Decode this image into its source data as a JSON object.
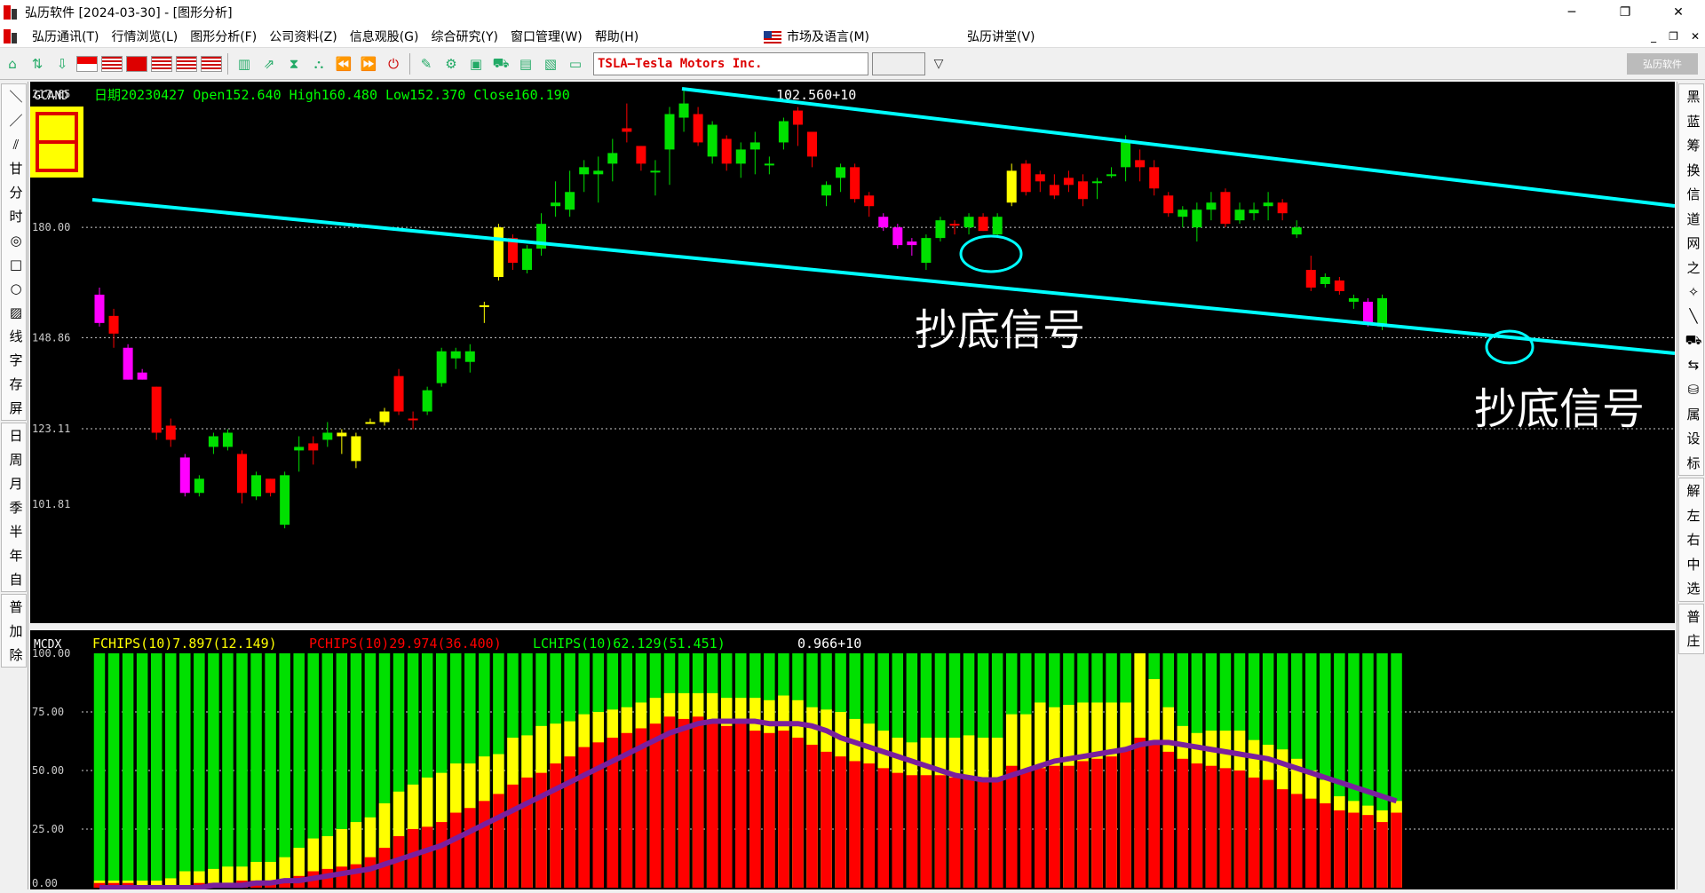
{
  "window": {
    "title": "弘历软件 [2024-03-30] - [图形分析]",
    "minimize": "─",
    "maximize": "❐",
    "close": "✕"
  },
  "menu": {
    "items": [
      "弘历通讯(T)",
      "行情浏览(L)",
      "图形分析(F)",
      "公司资料(Z)",
      "信息观股(G)",
      "综合研究(Y)",
      "窗口管理(W)",
      "帮助(H)"
    ],
    "market_lang": "市场及语言(M)",
    "lecture": "弘历讲堂(V)",
    "mdi_controls": [
      "_",
      "❐",
      "✕"
    ]
  },
  "toolbar": {
    "symbol": "TSLA—Tesla Motors Inc.",
    "brand": "弘历软件",
    "dropdown_icon": "▽"
  },
  "left_toolbar": {
    "tools_group1": [
      "＼",
      "／",
      "⫽",
      "甘",
      "分",
      "时",
      "◎",
      "□",
      "○",
      "▨",
      "线",
      "字",
      "存",
      "屏"
    ],
    "tools_group2": [
      "日",
      "周",
      "月",
      "季",
      "半",
      "年",
      "自"
    ],
    "tools_group3": [
      "普",
      "加",
      "除"
    ]
  },
  "right_toolbar": {
    "group1": [
      "黑",
      "蓝",
      "筹",
      "换",
      "信",
      "道",
      "网",
      "之",
      "✧",
      "╲",
      "⛟",
      "⇆",
      "⛁",
      "属",
      "设",
      "标"
    ],
    "group2": [
      "解",
      "左",
      "右",
      "中",
      "选"
    ],
    "group3": [
      "普",
      "庄"
    ]
  },
  "main_chart": {
    "indicator": "GCAND",
    "info": "日期20230427  Open152.640  High160.480  Low152.370  Close160.190",
    "center_label": "102.560+10",
    "y_labels": [
      "217.65",
      "180.00",
      "148.86",
      "123.11",
      "101.81"
    ],
    "annotation_1": "抄底信号",
    "annotation_2": "抄底信号",
    "colors": {
      "up": "#00e000",
      "down": "#ff0000",
      "yellow": "#ffff00",
      "magenta": "#ff00ff",
      "channel": "#00ffff",
      "background": "#000000"
    }
  },
  "sub_chart": {
    "indicator": "MCDX",
    "fchips": "FCHIPS(10)7.897(12.149)",
    "pchips": "PCHIPS(10)29.974(36.400)",
    "lchips": "LCHIPS(10)62.129(51.451)",
    "center_label": "0.966+10",
    "y_labels": [
      "100.00",
      "75.00",
      "50.00",
      "25.00",
      "0.00"
    ],
    "colors": {
      "red": "#ff0000",
      "yellow": "#ffff00",
      "green": "#00e000",
      "ma": "#7a1f9e"
    }
  },
  "chart_data": {
    "type": "candlestick",
    "y_axis_ticks": [
      217.65,
      180.0,
      148.86,
      123.11,
      101.81
    ],
    "candles": [
      {
        "o": 161,
        "h": 163,
        "l": 152,
        "c": 153,
        "col": "magenta"
      },
      {
        "o": 155,
        "h": 157,
        "l": 146,
        "c": 150,
        "col": "red"
      },
      {
        "o": 146,
        "h": 147,
        "l": 137,
        "c": 137,
        "col": "magenta"
      },
      {
        "o": 139,
        "h": 140,
        "l": 137,
        "c": 137,
        "col": "magenta"
      },
      {
        "o": 135,
        "h": 135,
        "l": 120,
        "c": 122,
        "col": "red"
      },
      {
        "o": 124,
        "h": 126,
        "l": 118,
        "c": 120,
        "col": "red"
      },
      {
        "o": 115,
        "h": 116,
        "l": 104,
        "c": 105,
        "col": "magenta"
      },
      {
        "o": 105,
        "h": 110,
        "l": 104,
        "c": 109,
        "col": "green"
      },
      {
        "o": 118,
        "h": 122,
        "l": 116,
        "c": 121,
        "col": "green"
      },
      {
        "o": 118,
        "h": 123,
        "l": 117,
        "c": 122,
        "col": "green"
      },
      {
        "o": 116,
        "h": 117,
        "l": 102,
        "c": 105,
        "col": "red"
      },
      {
        "o": 104,
        "h": 111,
        "l": 103,
        "c": 110,
        "col": "green"
      },
      {
        "o": 109,
        "h": 109,
        "l": 104,
        "c": 105,
        "col": "red"
      },
      {
        "o": 96,
        "h": 111,
        "l": 95,
        "c": 110,
        "col": "green"
      },
      {
        "o": 117,
        "h": 121,
        "l": 111,
        "c": 118,
        "col": "green"
      },
      {
        "o": 119,
        "h": 121,
        "l": 113,
        "c": 117,
        "col": "red"
      },
      {
        "o": 120,
        "h": 125,
        "l": 118,
        "c": 122,
        "col": "green"
      },
      {
        "o": 121,
        "h": 123,
        "l": 116,
        "c": 122,
        "col": "yellow"
      },
      {
        "o": 121,
        "h": 122,
        "l": 112,
        "c": 114,
        "col": "yellow"
      },
      {
        "o": 125,
        "h": 126,
        "l": 125,
        "c": 125,
        "col": "yellow"
      },
      {
        "o": 128,
        "h": 129,
        "l": 124,
        "c": 125,
        "col": "yellow"
      },
      {
        "o": 138,
        "h": 140,
        "l": 127,
        "c": 128,
        "col": "red"
      },
      {
        "o": 126,
        "h": 128,
        "l": 123,
        "c": 126,
        "col": "red"
      },
      {
        "o": 128,
        "h": 135,
        "l": 127,
        "c": 134,
        "col": "green"
      },
      {
        "o": 136,
        "h": 146,
        "l": 135,
        "c": 145,
        "col": "green"
      },
      {
        "o": 143,
        "h": 146,
        "l": 140,
        "c": 145,
        "col": "green"
      },
      {
        "o": 142,
        "h": 147,
        "l": 139,
        "c": 145,
        "col": "green"
      },
      {
        "o": 158,
        "h": 159,
        "l": 153,
        "c": 158,
        "col": "yellow"
      },
      {
        "o": 180,
        "h": 181,
        "l": 165,
        "c": 166,
        "col": "yellow"
      },
      {
        "o": 177,
        "h": 178,
        "l": 168,
        "c": 170,
        "col": "red"
      },
      {
        "o": 168,
        "h": 175,
        "l": 167,
        "c": 174,
        "col": "green"
      },
      {
        "o": 174,
        "h": 184,
        "l": 172,
        "c": 181,
        "col": "green"
      },
      {
        "o": 186,
        "h": 193,
        "l": 183,
        "c": 187,
        "col": "green"
      },
      {
        "o": 185,
        "h": 196,
        "l": 183,
        "c": 190,
        "col": "green"
      },
      {
        "o": 195,
        "h": 199,
        "l": 190,
        "c": 197,
        "col": "green"
      },
      {
        "o": 196,
        "h": 200,
        "l": 187,
        "c": 195,
        "col": "green"
      },
      {
        "o": 198,
        "h": 205,
        "l": 193,
        "c": 201,
        "col": "green"
      },
      {
        "o": 208,
        "h": 215,
        "l": 204,
        "c": 207,
        "col": "red"
      },
      {
        "o": 203,
        "h": 203,
        "l": 196,
        "c": 198,
        "col": "red"
      },
      {
        "o": 196,
        "h": 199,
        "l": 189,
        "c": 196,
        "col": "green"
      },
      {
        "o": 202,
        "h": 214,
        "l": 192,
        "c": 212,
        "col": "green"
      },
      {
        "o": 211,
        "h": 219,
        "l": 207,
        "c": 215,
        "col": "green"
      },
      {
        "o": 212,
        "h": 214,
        "l": 203,
        "c": 204,
        "col": "red"
      },
      {
        "o": 200,
        "h": 210,
        "l": 198,
        "c": 209,
        "col": "green"
      },
      {
        "o": 205,
        "h": 206,
        "l": 196,
        "c": 198,
        "col": "red"
      },
      {
        "o": 198,
        "h": 204,
        "l": 194,
        "c": 202,
        "col": "green"
      },
      {
        "o": 202,
        "h": 207,
        "l": 195,
        "c": 204,
        "col": "green"
      },
      {
        "o": 198,
        "h": 200,
        "l": 195,
        "c": 198,
        "col": "green"
      },
      {
        "o": 204,
        "h": 211,
        "l": 202,
        "c": 210,
        "col": "green"
      },
      {
        "o": 213,
        "h": 214,
        "l": 203,
        "c": 209,
        "col": "red"
      },
      {
        "o": 207,
        "h": 207,
        "l": 197,
        "c": 200,
        "col": "red"
      },
      {
        "o": 189,
        "h": 193,
        "l": 186,
        "c": 192,
        "col": "green"
      },
      {
        "o": 194,
        "h": 198,
        "l": 190,
        "c": 197,
        "col": "green"
      },
      {
        "o": 197,
        "h": 198,
        "l": 187,
        "c": 188,
        "col": "red"
      },
      {
        "o": 189,
        "h": 190,
        "l": 183,
        "c": 186,
        "col": "red"
      },
      {
        "o": 183,
        "h": 184,
        "l": 179,
        "c": 180,
        "col": "magenta"
      },
      {
        "o": 180,
        "h": 181,
        "l": 174,
        "c": 175,
        "col": "magenta"
      },
      {
        "o": 176,
        "h": 177,
        "l": 172,
        "c": 175,
        "col": "magenta"
      },
      {
        "o": 170,
        "h": 178,
        "l": 168,
        "c": 177,
        "col": "green"
      },
      {
        "o": 177,
        "h": 183,
        "l": 176,
        "c": 182,
        "col": "green"
      },
      {
        "o": 181,
        "h": 182,
        "l": 178,
        "c": 181,
        "col": "red"
      },
      {
        "o": 180,
        "h": 184,
        "l": 178,
        "c": 183,
        "col": "green"
      },
      {
        "o": 183,
        "h": 184,
        "l": 179,
        "c": 179,
        "col": "red"
      },
      {
        "o": 178,
        "h": 184,
        "l": 177,
        "c": 183,
        "col": "green"
      },
      {
        "o": 187,
        "h": 198,
        "l": 186,
        "c": 196,
        "col": "yellow"
      },
      {
        "o": 198,
        "h": 199,
        "l": 189,
        "c": 190,
        "col": "red"
      },
      {
        "o": 195,
        "h": 196,
        "l": 190,
        "c": 193,
        "col": "red"
      },
      {
        "o": 192,
        "h": 195,
        "l": 188,
        "c": 189,
        "col": "red"
      },
      {
        "o": 194,
        "h": 196,
        "l": 190,
        "c": 192,
        "col": "red"
      },
      {
        "o": 193,
        "h": 195,
        "l": 186,
        "c": 188,
        "col": "red"
      },
      {
        "o": 193,
        "h": 194,
        "l": 188,
        "c": 193,
        "col": "green"
      },
      {
        "o": 195,
        "h": 197,
        "l": 194,
        "c": 195,
        "col": "green"
      },
      {
        "o": 197,
        "h": 206,
        "l": 193,
        "c": 204,
        "col": "green"
      },
      {
        "o": 199,
        "h": 202,
        "l": 193,
        "c": 197,
        "col": "red"
      },
      {
        "o": 197,
        "h": 199,
        "l": 189,
        "c": 191,
        "col": "red"
      },
      {
        "o": 189,
        "h": 190,
        "l": 183,
        "c": 184,
        "col": "red"
      },
      {
        "o": 185,
        "h": 186,
        "l": 180,
        "c": 183,
        "col": "green"
      },
      {
        "o": 180,
        "h": 187,
        "l": 176,
        "c": 185,
        "col": "green"
      },
      {
        "o": 185,
        "h": 190,
        "l": 182,
        "c": 187,
        "col": "green"
      },
      {
        "o": 190,
        "h": 191,
        "l": 180,
        "c": 181,
        "col": "red"
      },
      {
        "o": 182,
        "h": 187,
        "l": 181,
        "c": 185,
        "col": "green"
      },
      {
        "o": 185,
        "h": 187,
        "l": 182,
        "c": 184,
        "col": "green"
      },
      {
        "o": 186,
        "h": 190,
        "l": 182,
        "c": 187,
        "col": "green"
      },
      {
        "o": 187,
        "h": 188,
        "l": 182,
        "c": 184,
        "col": "red"
      },
      {
        "o": 180,
        "h": 182,
        "l": 177,
        "c": 178,
        "col": "green"
      },
      {
        "o": 168,
        "h": 172,
        "l": 162,
        "c": 163,
        "col": "red"
      },
      {
        "o": 166,
        "h": 167,
        "l": 163,
        "c": 164,
        "col": "green"
      },
      {
        "o": 165,
        "h": 166,
        "l": 161,
        "c": 162,
        "col": "red"
      },
      {
        "o": 160,
        "h": 161,
        "l": 157,
        "c": 159,
        "col": "green"
      },
      {
        "o": 159,
        "h": 160,
        "l": 152,
        "c": 153,
        "col": "magenta"
      },
      {
        "o": 152,
        "h": 161,
        "l": 151,
        "c": 160,
        "col": "green"
      }
    ],
    "mcdx": {
      "red": [
        2,
        2,
        2,
        1,
        1,
        1,
        1,
        2,
        2,
        2,
        3,
        3,
        3,
        3,
        5,
        7,
        8,
        9,
        10,
        13,
        17,
        22,
        25,
        26,
        28,
        32,
        34,
        37,
        40,
        44,
        47,
        49,
        53,
        56,
        60,
        62,
        64,
        66,
        68,
        70,
        73,
        72,
        73,
        70,
        69,
        70,
        67,
        66,
        67,
        64,
        61,
        58,
        56,
        54,
        53,
        51,
        49,
        48,
        48,
        48,
        47,
        47,
        46,
        46,
        52,
        50,
        51,
        52,
        52,
        54,
        55,
        56,
        59,
        64,
        62,
        58,
        55,
        53,
        52,
        51,
        50,
        47,
        46,
        42,
        40,
        38,
        36,
        33,
        32,
        31,
        28,
        32
      ],
      "yellow": [
        1,
        1,
        1,
        2,
        2,
        3,
        6,
        5,
        6,
        7,
        6,
        8,
        8,
        10,
        12,
        14,
        14,
        16,
        18,
        17,
        19,
        19,
        19,
        21,
        21,
        21,
        19,
        19,
        17,
        20,
        18,
        20,
        17,
        15,
        14,
        13,
        12,
        11,
        11,
        11,
        10,
        11,
        10,
        13,
        12,
        11,
        14,
        14,
        15,
        16,
        16,
        18,
        19,
        18,
        17,
        16,
        15,
        14,
        16,
        16,
        17,
        18,
        18,
        18,
        22,
        24,
        28,
        25,
        26,
        25,
        24,
        23,
        20,
        36,
        27,
        19,
        14,
        13,
        15,
        16,
        17,
        16,
        15,
        17,
        15,
        12,
        10,
        6,
        5,
        4,
        5,
        5
      ],
      "ma": [
        0,
        0,
        0,
        0,
        0,
        0,
        0,
        0,
        1,
        1,
        1,
        2,
        2,
        3,
        3,
        4,
        5,
        6,
        7,
        8,
        10,
        12,
        14,
        16,
        18,
        21,
        24,
        27,
        30,
        33,
        36,
        39,
        42,
        45,
        48,
        51,
        54,
        57,
        60,
        63,
        66,
        68,
        70,
        71,
        71,
        71,
        71,
        70,
        70,
        70,
        69,
        67,
        64,
        62,
        60,
        58,
        56,
        54,
        52,
        50,
        48,
        47,
        46,
        46,
        48,
        50,
        52,
        54,
        55,
        56,
        57,
        58,
        59,
        61,
        62,
        62,
        61,
        60,
        59,
        58,
        57,
        56,
        55,
        53,
        51,
        49,
        47,
        45,
        43,
        41,
        39,
        37
      ]
    }
  }
}
